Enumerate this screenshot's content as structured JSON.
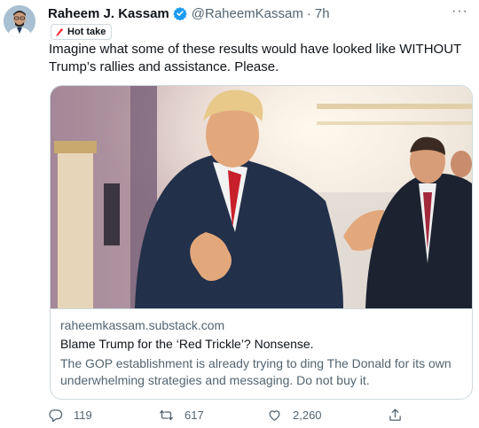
{
  "tweet": {
    "author_name": "Raheem J. Kassam",
    "handle": "@RaheemKassam",
    "separator": "·",
    "time": "7h",
    "label": "Hot take",
    "text": "Imagine what some of these results would have looked like WITHOUT Trump’s rallies and assistance. Please.",
    "more": "···"
  },
  "card": {
    "domain": "raheemkassam.substack.com",
    "title": "Blame Trump for the ‘Red Trickle’? Nonsense.",
    "description": "The GOP establishment is already trying to ding The Donald for its own underwhelming strategies and messaging. Do not buy it."
  },
  "actions": {
    "replies": "119",
    "retweets": "617",
    "likes": "2,260"
  },
  "icons": {
    "verified": "verified-badge-icon",
    "label": "fire-icon",
    "reply": "reply-icon",
    "retweet": "retweet-icon",
    "like": "heart-icon",
    "share": "share-icon"
  },
  "colors": {
    "verified": "#1d9bf0",
    "label_icon": "#f4212e",
    "secondary_text": "#536471",
    "primary_text": "#0f1419",
    "border": "#cfd9de"
  }
}
